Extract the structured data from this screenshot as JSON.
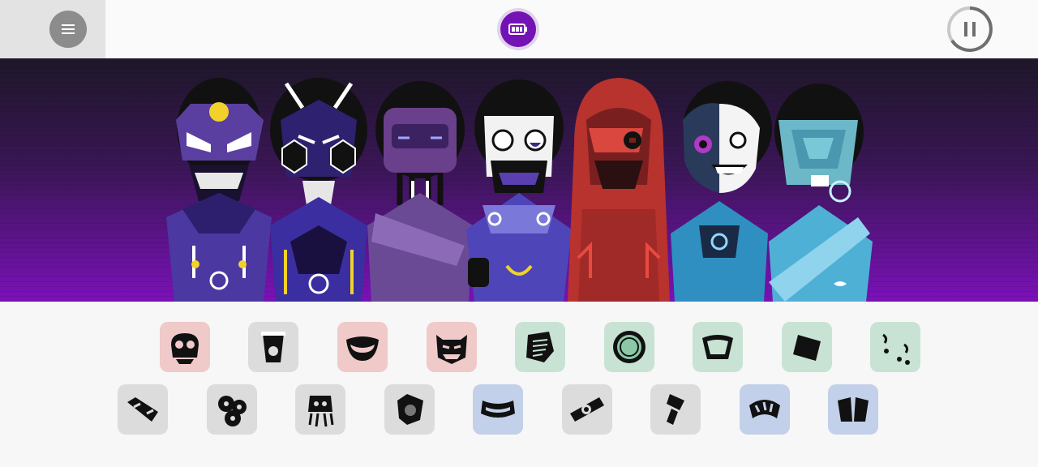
{
  "toolbar": {
    "menu_icon": "hamburger-menu-icon",
    "battery_icon": "battery-icon",
    "pause_icon": "pause-icon",
    "accent": "#7413b5"
  },
  "stage": {
    "background_top": "#1e1729",
    "background_bottom": "#7a11b8",
    "characters": [
      {
        "slot": 1,
        "theme": "violet-skull-helmet",
        "color": "#5a3fa0"
      },
      {
        "slot": 2,
        "theme": "dark-horned-mask",
        "color": "#4a33a0"
      },
      {
        "slot": 3,
        "theme": "purple-tube-mask",
        "color": "#6a3f8c"
      },
      {
        "slot": 4,
        "theme": "white-face-gasmask",
        "color": "#5b4bb0"
      },
      {
        "slot": 5,
        "theme": "red-hooded-mask",
        "color": "#b8322e"
      },
      {
        "slot": 6,
        "theme": "half-cyborg-smile",
        "color": "#2f8fc0"
      },
      {
        "slot": 7,
        "theme": "cyan-visor",
        "color": "#4fb0d6"
      }
    ]
  },
  "sounds": {
    "row1": [
      {
        "icon": "pink-skull-sound-icon",
        "tint": "red"
      },
      {
        "icon": "cup-sound-icon",
        "tint": "gray"
      },
      {
        "icon": "mouth-sound-icon",
        "tint": "red"
      },
      {
        "icon": "monster-face-sound-icon",
        "tint": "red"
      },
      {
        "icon": "notepad-sound-icon",
        "tint": "green"
      },
      {
        "icon": "sun-disc-sound-icon",
        "tint": "green"
      },
      {
        "icon": "bowl-sound-icon",
        "tint": "green"
      },
      {
        "icon": "square-chip-sound-icon",
        "tint": "green"
      },
      {
        "icon": "swirl-dots-sound-icon",
        "tint": "green"
      }
    ],
    "row2": [
      {
        "icon": "bolt-capsule-sound-icon",
        "tint": "gray"
      },
      {
        "icon": "gear-cluster-sound-icon",
        "tint": "gray"
      },
      {
        "icon": "squid-sound-icon",
        "tint": "gray"
      },
      {
        "icon": "shield-face-sound-icon",
        "tint": "gray"
      },
      {
        "icon": "headband-sound-icon",
        "tint": "blue"
      },
      {
        "icon": "eye-scope-sound-icon",
        "tint": "gray"
      },
      {
        "icon": "hammer-sound-icon",
        "tint": "gray"
      },
      {
        "icon": "striped-ring-sound-icon",
        "tint": "blue"
      },
      {
        "icon": "visor-sound-icon",
        "tint": "blue"
      }
    ]
  }
}
